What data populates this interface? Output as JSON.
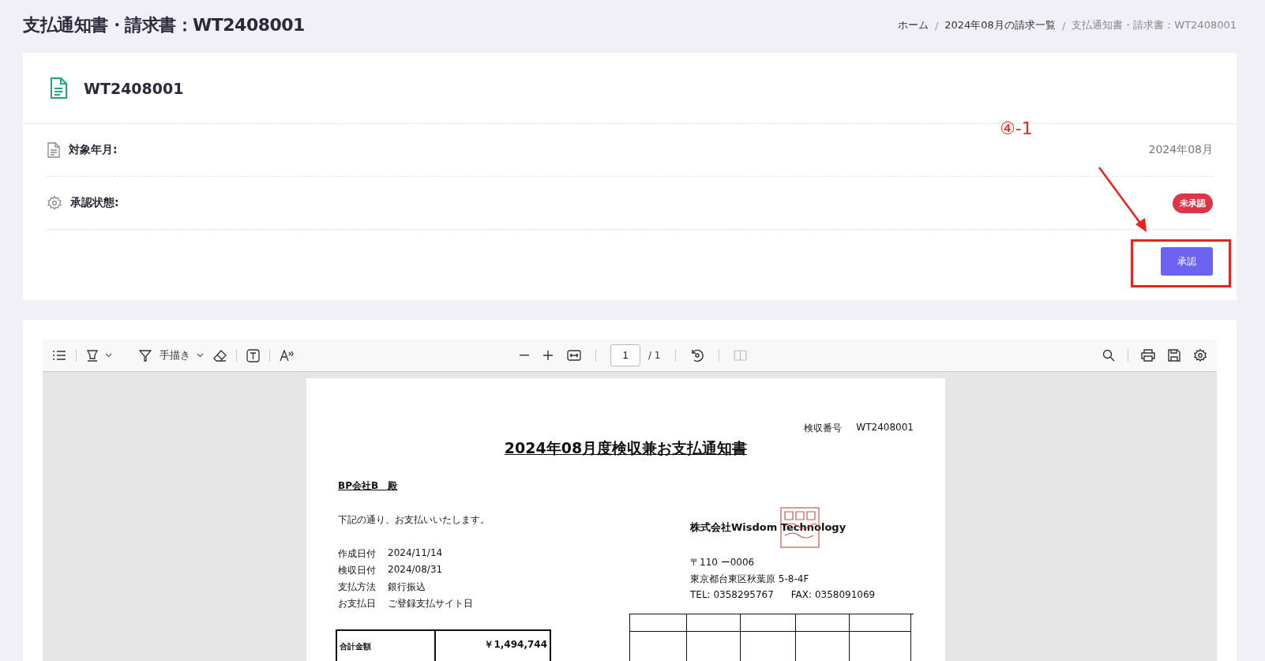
{
  "page_title": "支払通知書・請求書：WT2408001",
  "breadcrumbs": [
    {
      "label": "ホーム",
      "current": false
    },
    {
      "separator": "/",
      "label": "2024年08月の請求一覧",
      "current": false
    },
    {
      "separator": "/",
      "label": "支払通知書・請求書：WT2408001",
      "current": true
    }
  ],
  "summary": {
    "doc_id": "WT2408001",
    "fields": [
      {
        "label": "対象年月:",
        "kind": "text",
        "value": "2024年08月"
      },
      {
        "label": "承認状態:",
        "kind": "badge",
        "value": "未承認",
        "color": "#dc3545"
      }
    ],
    "approve_button": "承認"
  },
  "annotation": {
    "label": "④-1"
  },
  "viewer": {
    "toolbar_left": [
      {
        "kind": "list"
      },
      {
        "kind": "sep"
      },
      {
        "kind": "highlighter"
      },
      {
        "kind": "caret"
      },
      {
        "kind": "gap"
      },
      {
        "kind": "pen",
        "label": "手描き"
      },
      {
        "kind": "caret"
      },
      {
        "kind": "eraser"
      },
      {
        "kind": "sep"
      },
      {
        "kind": "textbox"
      },
      {
        "kind": "sep"
      },
      {
        "kind": "textsize"
      }
    ],
    "page_input": "1",
    "page_total": "/ 1",
    "toolbar_right": [
      {
        "kind": "search"
      },
      {
        "kind": "sep"
      },
      {
        "kind": "print"
      },
      {
        "kind": "save"
      },
      {
        "kind": "gear"
      }
    ]
  },
  "document": {
    "number_label": "検収番号",
    "number": "WT2408001",
    "title": "2024年08月度検収兼お支払通知書",
    "addressee": "BP会社B　殿",
    "intro": "下記の通り、お支払いいたします。",
    "details": [
      {
        "label": "作成日付",
        "value": "2024/11/14"
      },
      {
        "label": "検収日付",
        "value": "2024/08/31"
      },
      {
        "label": "支払方法",
        "value": "銀行振込"
      },
      {
        "label": "お支払日",
        "value": "ご登録支払サイト日"
      }
    ],
    "company": "株式会社Wisdom Technology",
    "postal": "〒110 ー0006",
    "address": "東京都台東区秋葉原 5-8-4F",
    "tel": "TEL: 0358295767",
    "fax": "FAX: 0358091069",
    "total_label": "合計金額",
    "total_value": "￥1,494,744"
  }
}
